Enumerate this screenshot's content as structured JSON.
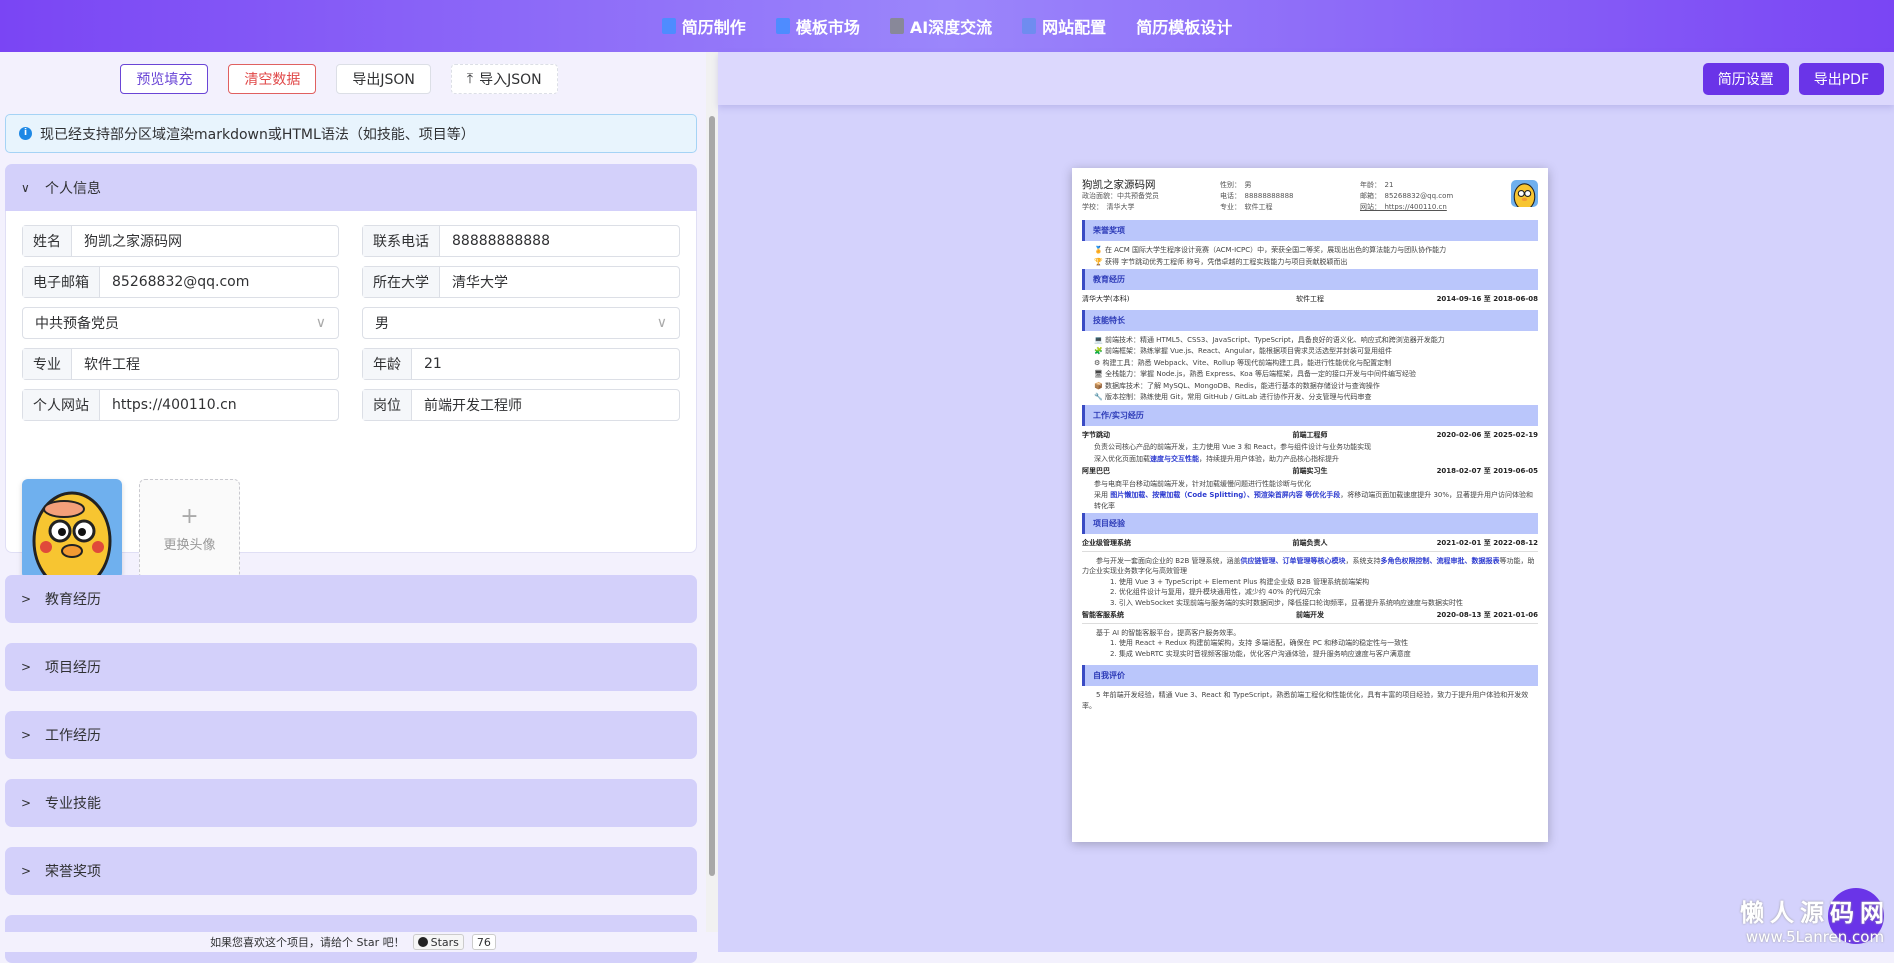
{
  "nav": [
    {
      "label": "简历制作",
      "icon": "pen-icon"
    },
    {
      "label": "模板市场",
      "icon": "template-icon"
    },
    {
      "label": "AI深度交流",
      "icon": "robot-icon"
    },
    {
      "label": "网站配置",
      "icon": "settings-doc-icon"
    },
    {
      "label": "简历模板设计",
      "icon": ""
    }
  ],
  "toolbar": {
    "preview": "预览填充",
    "clear": "清空数据",
    "export_json": "导出JSON",
    "import_json": "导入JSON"
  },
  "alert": "现已经支持部分区域渲染markdown或HTML语法（如技能、项目等）",
  "personal": {
    "title": "个人信息",
    "fields": {
      "name_label": "姓名",
      "name": "狗凯之家源码网",
      "phone_label": "联系电话",
      "phone": "88888888888",
      "email_label": "电子邮箱",
      "email": "85268832@qq.com",
      "univ_label": "所在大学",
      "univ": "清华大学",
      "political": "中共预备党员",
      "gender": "男",
      "major_label": "专业",
      "major": "软件工程",
      "age_label": "年龄",
      "age": "21",
      "site_label": "个人网站",
      "site": "https://400110.cn",
      "job_label": "岗位",
      "job": "前端开发工程师"
    },
    "upload": "更换头像"
  },
  "sections": [
    "教育经历",
    "项目经历",
    "工作经历",
    "专业技能",
    "荣誉奖项"
  ],
  "footer": {
    "text": "如果您喜欢这个项目，请给个 Star 吧！",
    "stars_label": "Stars",
    "stars": "76"
  },
  "right_toolbar": {
    "settings": "简历设置",
    "export_pdf": "导出PDF"
  },
  "resume": {
    "name": "狗凯之家源码网",
    "info": [
      [
        "政治面貌：中共预备党员",
        "性别：　男",
        "年龄：　21"
      ],
      [
        "学校：　清华大学",
        "电话：　88888888888",
        "邮箱：　85268832@qq.com"
      ],
      [
        "",
        "专业：　软件工程",
        "网站：　https://400110.cn"
      ]
    ],
    "honor_title": "荣誉奖项",
    "honors": [
      "🏅 在 ACM 国际大学生程序设计竞赛（ACM-ICPC）中，荣获全国二等奖，展现出出色的算法能力与团队协作能力",
      "🏆 获得 字节跳动优秀工程师 称号，凭借卓越的工程实践能力与项目贡献脱颖而出"
    ],
    "edu_title": "教育经历",
    "edu": {
      "school": "清华大学(本科)",
      "major": "软件工程",
      "date": "2014-09-16 至 2018-06-08"
    },
    "skill_title": "技能特长",
    "skills": [
      "💻 前端技术：精通 HTML5、CSS3、JavaScript、TypeScript，具备良好的语义化、响应式和跨浏览器开发能力",
      "🧩 前端框架：熟练掌握 Vue.js、React、Angular，能根据项目需求灵活选型并封装可复用组件",
      "⚙ 构建工具：熟悉 Webpack、Vite、Rollup 等现代前端构建工具，能进行性能优化与配置定制",
      "🖥 全栈能力：掌握 Node.js，熟悉 Express、Koa 等后端框架，具备一定的接口开发与中间件编写经验",
      "📦 数据库技术：了解 MySQL、MongoDB、Redis，能进行基本的数据存储设计与查询操作",
      "🔧 版本控制：熟练使用 Git，常用 GitHub / GitLab 进行协作开发、分支管理与代码审查"
    ],
    "work_title": "工作/实习经历",
    "work": [
      {
        "company": "字节跳动",
        "role": "前端工程师",
        "date": "2020-02-06 至 2025-02-19",
        "l1": "负责公司核心产品的前端开发，主力使用 Vue 3 和 React，参与组件设计与业务功能实现",
        "l2a": "深入优化页面加载",
        "l2b": "速度与交互性能",
        "l2c": "，持续提升用户体验，助力产品核心指标提升"
      },
      {
        "company": "阿里巴巴",
        "role": "前端实习生",
        "date": "2018-02-07 至 2019-06-05",
        "l1": "参与电商平台移动端前端开发，针对加载缓慢问题进行性能诊断与优化",
        "l2a": "采用 ",
        "l2b": "图片懒加载、按需加载（Code Splitting）、预渲染首屏内容 等优化手段",
        "l2c": "，将移动端页面加载速度提升 30%，显著提升用户访问体验和转化率"
      }
    ],
    "proj_title": "项目经验",
    "projects": [
      {
        "name": "企业级管理系统",
        "role": "前端负责人",
        "date": "2021-02-01 至 2022-08-12",
        "desc_a": "参与开发一套面向企业的 B2B 管理系统，涵盖",
        "desc_b": "供应链管理、订单管理等核心模块",
        "desc_c": "，系统支持",
        "desc_d": "多角色权限控制、流程审批、数据报表",
        "desc_e": "等功能，助力企业实现业务数字化与高效管理",
        "items": [
          "1. 使用 Vue 3 + TypeScript + Element Plus 构建企业级 B2B 管理系统前端架构",
          "2. 优化组件设计与复用，提升模块通用性，减少约 40% 的代码冗余",
          "3. 引入 WebSocket 实现前端与服务端的实时数据同步，降低接口轮询频率，显著提升系统响应速度与数据实时性"
        ]
      },
      {
        "name": "智能客服系统",
        "role": "前端开发",
        "date": "2020-08-13 至 2021-01-06",
        "desc_a": "基于 AI 的智能客服平台，提高客户服务效率。",
        "items": [
          "1. 使用 React + Redux 构建前端架构，支持 多端适配，确保在 PC 和移动端的稳定性与一致性",
          "2. 集成 WebRTC 实现实时音视频客服功能，优化客户沟通体验，提升服务响应速度与客户满意度"
        ]
      }
    ],
    "self_title": "自我评价",
    "self": "5 年前端开发经验，精通 Vue 3、React 和 TypeScript，熟悉前端工程化和性能优化，具有丰富的项目经验，致力于提升用户体验和开发效率。"
  },
  "watermark": {
    "cn": "懒人源码网",
    "url": "www.5Lanren.com"
  }
}
